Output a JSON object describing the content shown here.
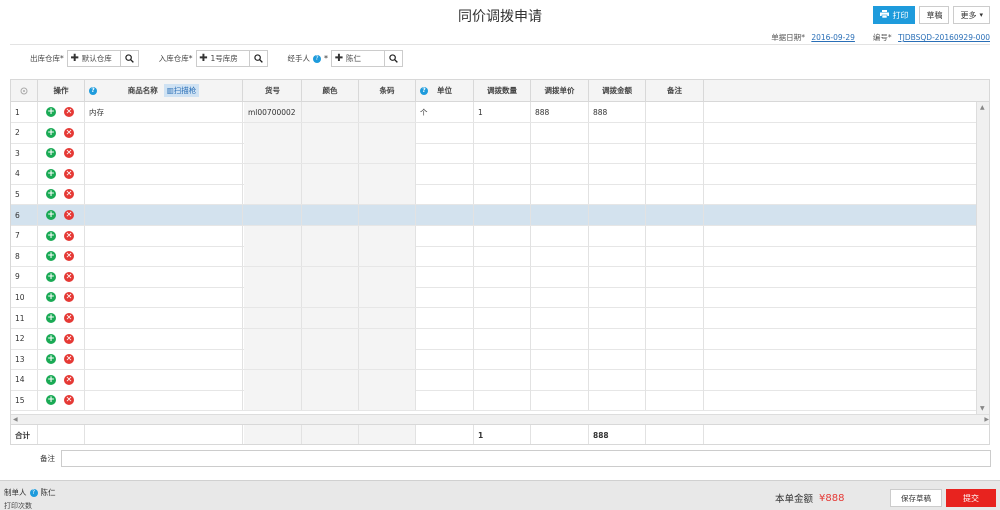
{
  "header": {
    "title": "同价调拨申请",
    "print_label": "打印",
    "draft_label": "草稿",
    "more_label": "更多"
  },
  "meta": {
    "date_label": "单据日期",
    "date_value": "2016-09-29",
    "number_label": "编号",
    "number_value": "TJDBSQD-20160929-000"
  },
  "filters": {
    "out_label": "出库仓库",
    "out_value": "默认仓库",
    "in_label": "入库仓库",
    "in_value": "1号库房",
    "handler_label": "经手人",
    "handler_value": "陈仁"
  },
  "columns": {
    "ops": "操作",
    "name": "商品名称",
    "scan": "扫描枪",
    "code": "货号",
    "color": "颜色",
    "barcode": "条码",
    "unit": "单位",
    "qty": "调拨数量",
    "price": "调拨单价",
    "amount": "调拨金额",
    "note": "备注"
  },
  "rows": [
    {
      "no": "1",
      "name": "内存",
      "code": "ml00700002",
      "unit": "个",
      "qty": "1",
      "price": "888",
      "amount": "888"
    },
    {
      "no": "2"
    },
    {
      "no": "3"
    },
    {
      "no": "4"
    },
    {
      "no": "5"
    },
    {
      "no": "6"
    },
    {
      "no": "7"
    },
    {
      "no": "8"
    },
    {
      "no": "9"
    },
    {
      "no": "10"
    },
    {
      "no": "11"
    },
    {
      "no": "12"
    },
    {
      "no": "13"
    },
    {
      "no": "14"
    },
    {
      "no": "15"
    }
  ],
  "total": {
    "label": "合计",
    "qty": "1",
    "amount": "888"
  },
  "remark": {
    "label": "备注",
    "value": ""
  },
  "footer": {
    "creator_label": "制单人",
    "creator_value": "陈仁",
    "print_count_label": "打印次数",
    "amount_label": "本单金额",
    "amount_value": "¥888",
    "save_label": "保存草稿",
    "submit_label": "提交"
  },
  "colors": {
    "primary": "#1e9bdc",
    "submit": "#e8231f",
    "selected_row": "#d3e2ee"
  }
}
